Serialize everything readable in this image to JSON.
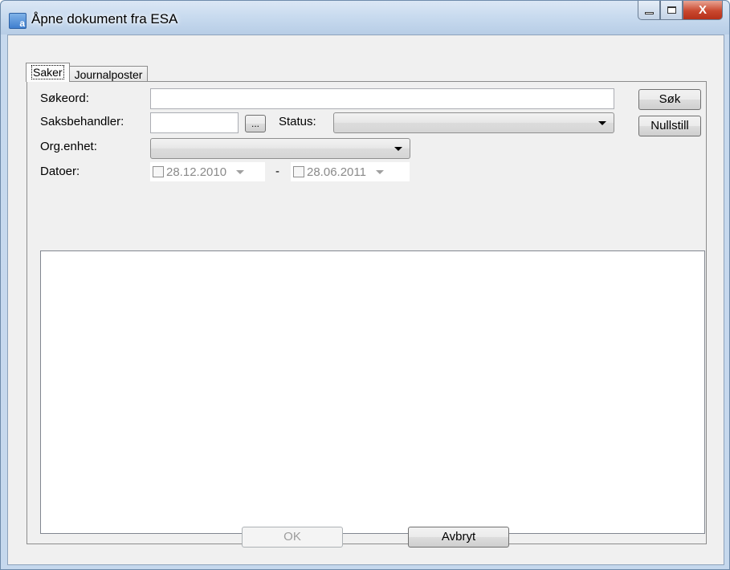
{
  "window": {
    "title": "Åpne dokument fra ESA",
    "minimize_label": "",
    "maximize_label": "",
    "close_label": "X"
  },
  "tabs": [
    {
      "label": "Saker",
      "active": true
    },
    {
      "label": "Journalposter",
      "active": false
    }
  ],
  "form": {
    "search_label": "Søkeord:",
    "search_value": "",
    "handler_label": "Saksbehandler:",
    "handler_value": "",
    "handler_browse_label": "...",
    "status_label": "Status:",
    "status_value": "",
    "org_label": "Org.enhet:",
    "org_value": "",
    "dates_label": "Datoer:",
    "date_from": "28.12.2010",
    "date_separator": "-",
    "date_to": "28.06.2011",
    "search_button": "Søk",
    "reset_button": "Nullstill"
  },
  "footer": {
    "ok_button": "OK",
    "cancel_button": "Avbryt"
  },
  "colors": {
    "window_frame": "#c5d8ed",
    "client_bg": "#f0f0f0",
    "close_button": "#c9482f"
  }
}
